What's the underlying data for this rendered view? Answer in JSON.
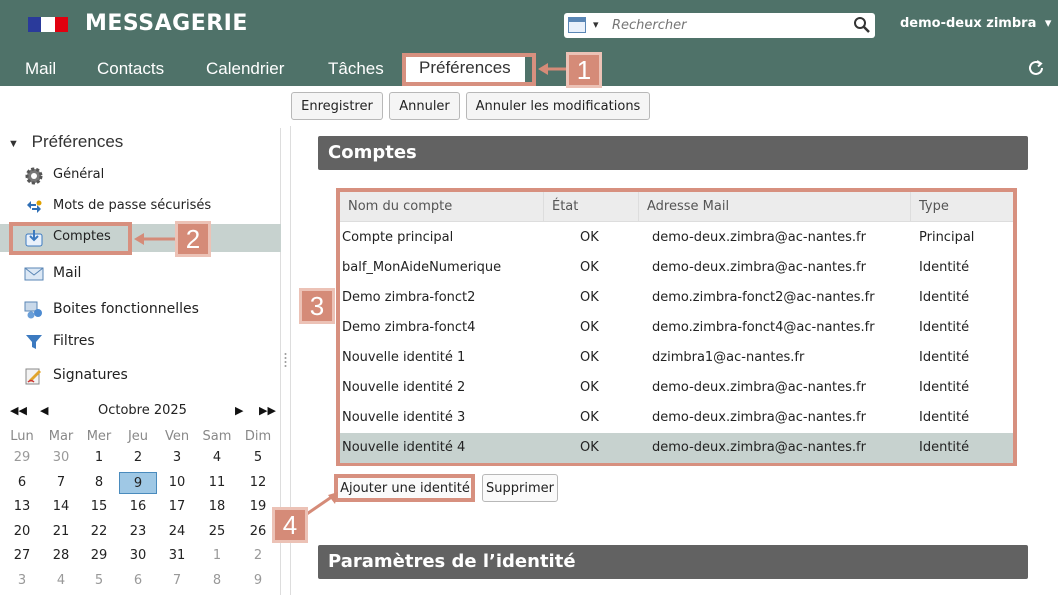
{
  "header": {
    "app_title": "MESSAGERIE",
    "search_placeholder": "Rechercher",
    "user": "demo-deux zimbra",
    "user_caret": "▾",
    "search_caret": "▾"
  },
  "tabs": [
    "Mail",
    "Contacts",
    "Calendrier",
    "Tâches",
    "Préférences"
  ],
  "active_tab": "Préférences",
  "toolbar": {
    "save": "Enregistrer",
    "cancel": "Annuler",
    "revert": "Annuler les modifications"
  },
  "sidebar": {
    "title": "Préférences",
    "toggle": "▼",
    "items": [
      {
        "label": "Général",
        "icon": "gear-icon"
      },
      {
        "label": "Mots de passe sécurisés",
        "icon": "password-icon"
      },
      {
        "label": "Comptes",
        "icon": "accounts-icon"
      },
      {
        "label": "Mail",
        "icon": "mail-icon"
      },
      {
        "label": "Boites fonctionnelles",
        "icon": "mailboxes-icon"
      },
      {
        "label": "Filtres",
        "icon": "filter-icon"
      },
      {
        "label": "Signatures",
        "icon": "signature-icon"
      }
    ],
    "selected": "Comptes"
  },
  "calendar": {
    "month": "Octobre 2025",
    "nav": {
      "prev_year": "◀◀",
      "prev": "◀",
      "next": "▶",
      "next_year": "▶▶"
    },
    "weekdays": [
      "Lun",
      "Mar",
      "Mer",
      "Jeu",
      "Ven",
      "Sam",
      "Dim"
    ],
    "weeks": [
      [
        "29",
        "30",
        "1",
        "2",
        "3",
        "4",
        "5"
      ],
      [
        "6",
        "7",
        "8",
        "9",
        "10",
        "11",
        "12"
      ],
      [
        "13",
        "14",
        "15",
        "16",
        "17",
        "18",
        "19"
      ],
      [
        "20",
        "21",
        "22",
        "23",
        "24",
        "25",
        "26"
      ],
      [
        "27",
        "28",
        "29",
        "30",
        "31",
        "1",
        "2"
      ],
      [
        "3",
        "4",
        "5",
        "6",
        "7",
        "8",
        "9"
      ]
    ],
    "today": "9"
  },
  "accounts": {
    "title": "Comptes",
    "columns": [
      "Nom du compte",
      "État",
      "Adresse Mail",
      "Type"
    ],
    "rows": [
      {
        "name": "Compte principal",
        "state": "OK",
        "email": "demo-deux.zimbra@ac-nantes.fr",
        "type": "Principal"
      },
      {
        "name": "balf_MonAideNumerique",
        "state": "OK",
        "email": "demo-deux.zimbra@ac-nantes.fr",
        "type": "Identité"
      },
      {
        "name": "Demo zimbra-fonct2",
        "state": "OK",
        "email": "demo.zimbra-fonct2@ac-nantes.fr",
        "type": "Identité"
      },
      {
        "name": "Demo zimbra-fonct4",
        "state": "OK",
        "email": "demo.zimbra-fonct4@ac-nantes.fr",
        "type": "Identité"
      },
      {
        "name": "Nouvelle identité 1",
        "state": "OK",
        "email": "dzimbra1@ac-nantes.fr",
        "type": "Identité"
      },
      {
        "name": "Nouvelle identité 2",
        "state": "OK",
        "email": "demo-deux.zimbra@ac-nantes.fr",
        "type": "Identité"
      },
      {
        "name": "Nouvelle identité 3",
        "state": "OK",
        "email": "demo-deux.zimbra@ac-nantes.fr",
        "type": "Identité"
      },
      {
        "name": "Nouvelle identité 4",
        "state": "OK",
        "email": "demo-deux.zimbra@ac-nantes.fr",
        "type": "Identité"
      }
    ],
    "selected_row": 7,
    "add_identity": "Ajouter une identité",
    "delete": "Supprimer"
  },
  "identity_section": {
    "title": "Paramètres de l’identité"
  },
  "annotations": {
    "badges": [
      "1",
      "2",
      "3",
      "4"
    ],
    "color": "#d58b78"
  },
  "colors": {
    "header": "#4f7269",
    "section": "#626262",
    "selected": "#c7d2cf",
    "highlight": "#d7907f"
  }
}
